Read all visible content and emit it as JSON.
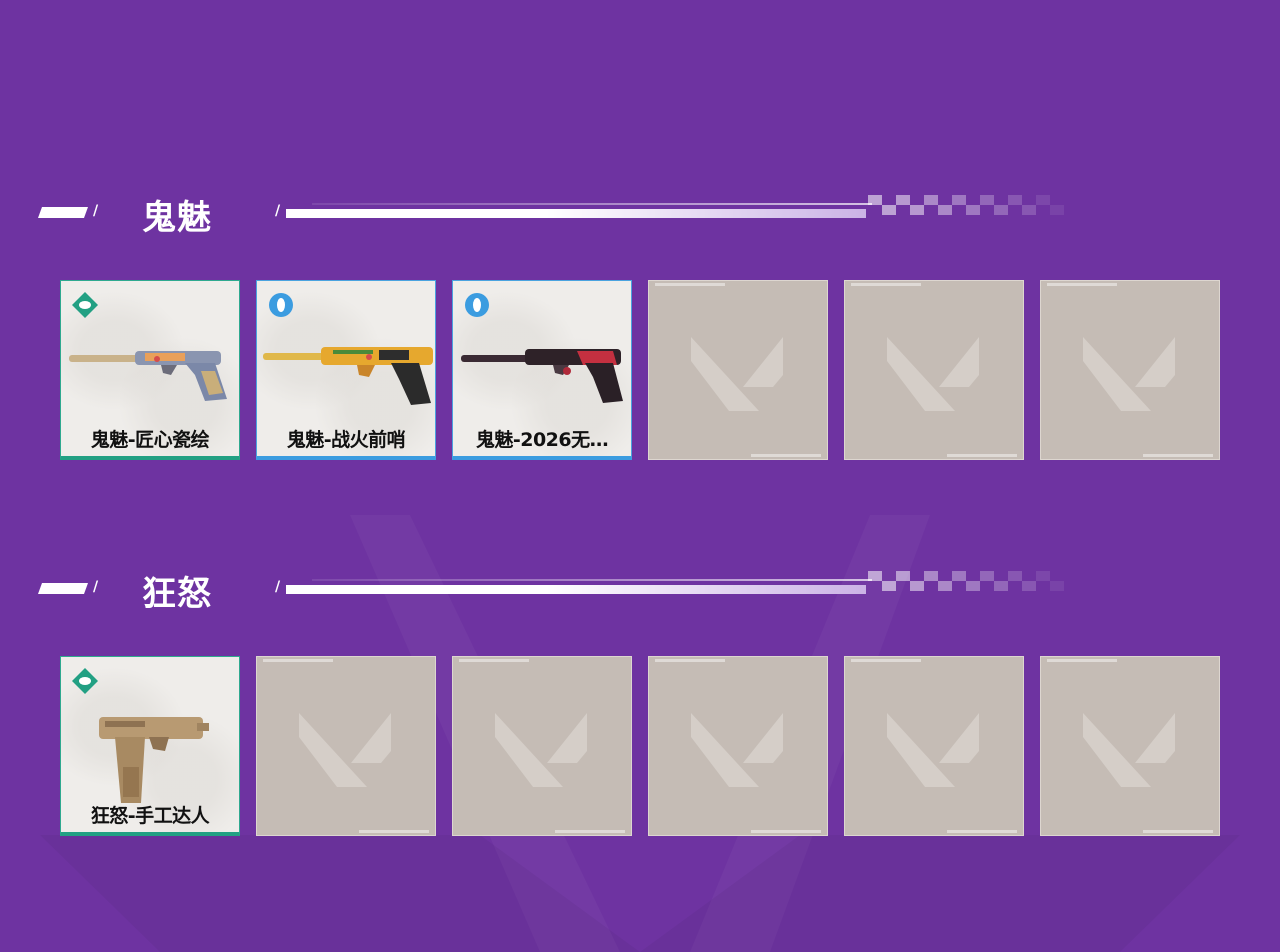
{
  "colors": {
    "background": "#6e33a1",
    "card_bg": "#efedea",
    "empty_card_bg": "#c5bcb5",
    "tier_green": "#22a083",
    "tier_blue": "#3b9ce0"
  },
  "sections": [
    {
      "title": "鬼魅",
      "cards": [
        {
          "name": "鬼魅-匠心瓷绘",
          "tier_icon": "green-diamond-tier-icon",
          "image": "ghost-porcelain-pistol-image"
        },
        {
          "name": "鬼魅-战火前哨",
          "tier_icon": "blue-circle-tier-icon",
          "image": "ghost-orange-pistol-image"
        },
        {
          "name": "鬼魅-2026无…",
          "tier_icon": "blue-circle-tier-icon",
          "image": "ghost-dark-red-pistol-image"
        },
        {
          "empty": true
        },
        {
          "empty": true
        },
        {
          "empty": true
        }
      ]
    },
    {
      "title": "狂怒",
      "cards": [
        {
          "name": "狂怒-手工达人",
          "tier_icon": "green-diamond-tier-icon",
          "image": "frenzy-cardboard-pistol-image"
        },
        {
          "empty": true
        },
        {
          "empty": true
        },
        {
          "empty": true
        },
        {
          "empty": true
        },
        {
          "empty": true
        }
      ]
    }
  ]
}
